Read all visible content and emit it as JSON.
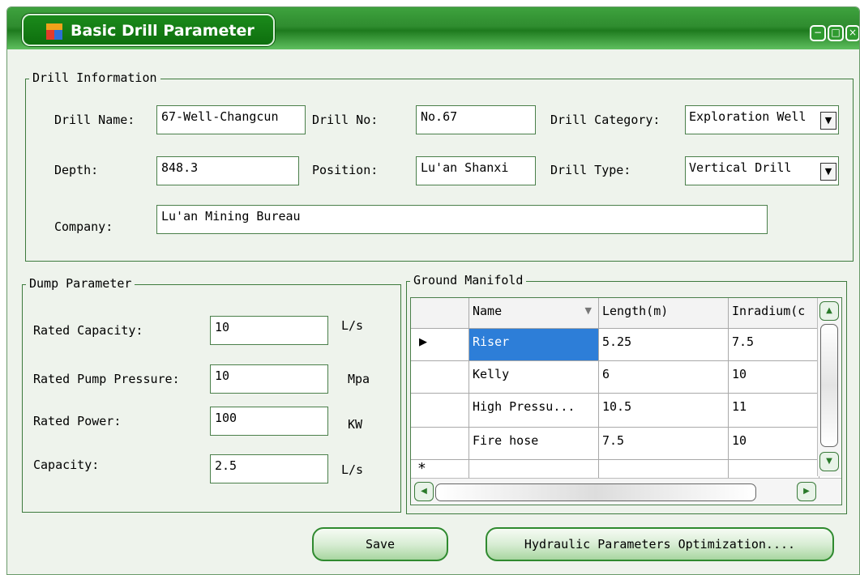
{
  "window": {
    "title": "Basic Drill Parameter",
    "controls": {
      "minimize": "−",
      "maximize": "□",
      "close": "×"
    }
  },
  "drill_info": {
    "legend": "Drill Information",
    "drill_name_label": "Drill Name:",
    "drill_name_value": "67-Well-Changcun",
    "drill_no_label": "Drill No:",
    "drill_no_value": "No.67",
    "drill_category_label": "Drill Category:",
    "drill_category_value": "Exploration Well",
    "depth_label": "Depth:",
    "depth_value": "848.3",
    "position_label": "Position:",
    "position_value": "Lu'an Shanxi",
    "drill_type_label": "Drill Type:",
    "drill_type_value": "Vertical Drill",
    "company_label": "Company:",
    "company_value": "Lu'an Mining Bureau"
  },
  "dump": {
    "legend": "Dump Parameter",
    "rated_capacity_label": "Rated Capacity:",
    "rated_capacity_value": "10",
    "rated_capacity_unit": "L/s",
    "rated_pressure_label": "Rated Pump Pressure:",
    "rated_pressure_value": "10",
    "rated_pressure_unit": "Mpa",
    "rated_power_label": "Rated Power:",
    "rated_power_value": "100",
    "rated_power_unit": "KW",
    "capacity_label": "Capacity:",
    "capacity_value": "2.5",
    "capacity_unit": "L/s"
  },
  "manifold": {
    "legend": "Ground Manifold",
    "columns": [
      "Name",
      "Length(m)",
      "Inradium(c"
    ],
    "rows": [
      [
        "Riser",
        "5.25",
        "7.5"
      ],
      [
        "Kelly",
        "6",
        "10"
      ],
      [
        "High Pressu...",
        "10.5",
        "11"
      ],
      [
        "Fire hose",
        "7.5",
        "10"
      ]
    ],
    "current_row_marker": "▶",
    "new_row_marker": "*"
  },
  "buttons": {
    "save": "Save",
    "optimize": "Hydraulic Parameters Optimization...."
  }
}
